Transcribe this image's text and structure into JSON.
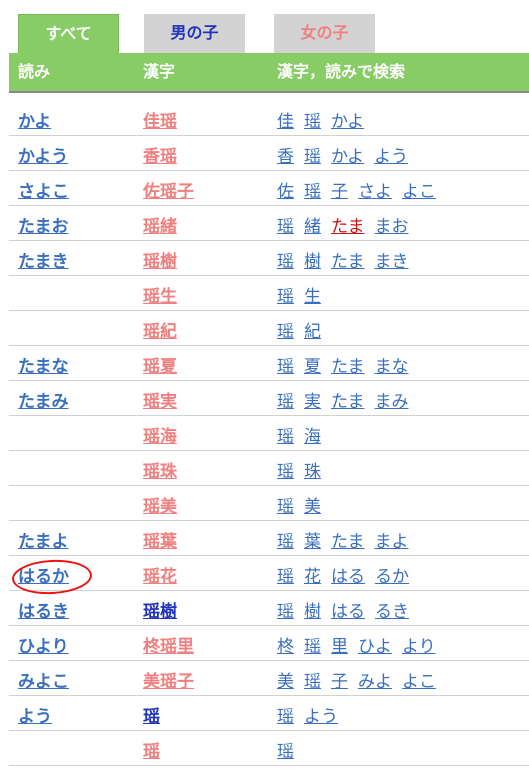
{
  "tabs": [
    {
      "label": "すべて",
      "active": true
    },
    {
      "label": "男の子",
      "active": false
    },
    {
      "label": "女の子",
      "active": false
    }
  ],
  "header": {
    "yomi": "読み",
    "kanji": "漢字",
    "search": "漢字，読みで検索"
  },
  "colors": {
    "tab_active_bg": "#88cc66",
    "header_bg": "#88cc66",
    "link_blue": "#3a6fbf",
    "girl_pink": "#f08080",
    "boy_blue": "#2233bb",
    "visited_red": "#cc1111",
    "annotation_red": "#ee1111"
  },
  "rows": [
    {
      "yomi": "かよ",
      "kanji": "佳瑶",
      "gender": "girl",
      "links": [
        {
          "t": "佳"
        },
        {
          "t": "瑶"
        },
        {
          "t": "かよ"
        }
      ]
    },
    {
      "yomi": "かよう",
      "kanji": "香瑶",
      "gender": "girl",
      "links": [
        {
          "t": "香"
        },
        {
          "t": "瑶"
        },
        {
          "t": "かよ"
        },
        {
          "t": "よう"
        }
      ]
    },
    {
      "yomi": "さよこ",
      "kanji": "佐瑶子",
      "gender": "girl",
      "links": [
        {
          "t": "佐"
        },
        {
          "t": "瑶"
        },
        {
          "t": "子"
        },
        {
          "t": "さよ"
        },
        {
          "t": "よこ"
        }
      ]
    },
    {
      "yomi": "たまお",
      "kanji": "瑶緒",
      "gender": "girl",
      "links": [
        {
          "t": "瑶"
        },
        {
          "t": "緒"
        },
        {
          "t": "たま",
          "visited": true
        },
        {
          "t": "まお"
        }
      ]
    },
    {
      "yomi": "たまき",
      "kanji": "瑶樹",
      "gender": "girl",
      "links": [
        {
          "t": "瑶"
        },
        {
          "t": "樹"
        },
        {
          "t": "たま"
        },
        {
          "t": "まき"
        }
      ]
    },
    {
      "yomi": "",
      "kanji": "瑶生",
      "gender": "girl",
      "links": [
        {
          "t": "瑶"
        },
        {
          "t": "生"
        }
      ]
    },
    {
      "yomi": "",
      "kanji": "瑶紀",
      "gender": "girl",
      "links": [
        {
          "t": "瑶"
        },
        {
          "t": "紀"
        }
      ]
    },
    {
      "yomi": "たまな",
      "kanji": "瑶夏",
      "gender": "girl",
      "links": [
        {
          "t": "瑶"
        },
        {
          "t": "夏"
        },
        {
          "t": "たま"
        },
        {
          "t": "まな"
        }
      ]
    },
    {
      "yomi": "たまみ",
      "kanji": "瑶実",
      "gender": "girl",
      "links": [
        {
          "t": "瑶"
        },
        {
          "t": "実"
        },
        {
          "t": "たま"
        },
        {
          "t": "まみ"
        }
      ]
    },
    {
      "yomi": "",
      "kanji": "瑶海",
      "gender": "girl",
      "links": [
        {
          "t": "瑶"
        },
        {
          "t": "海"
        }
      ]
    },
    {
      "yomi": "",
      "kanji": "瑶珠",
      "gender": "girl",
      "links": [
        {
          "t": "瑶"
        },
        {
          "t": "珠"
        }
      ]
    },
    {
      "yomi": "",
      "kanji": "瑶美",
      "gender": "girl",
      "links": [
        {
          "t": "瑶"
        },
        {
          "t": "美"
        }
      ]
    },
    {
      "yomi": "たまよ",
      "kanji": "瑶葉",
      "gender": "girl",
      "links": [
        {
          "t": "瑶"
        },
        {
          "t": "葉"
        },
        {
          "t": "たま"
        },
        {
          "t": "まよ"
        }
      ]
    },
    {
      "yomi": "はるか",
      "kanji": "瑶花",
      "gender": "girl",
      "annotated": true,
      "links": [
        {
          "t": "瑶"
        },
        {
          "t": "花"
        },
        {
          "t": "はる"
        },
        {
          "t": "るか"
        }
      ]
    },
    {
      "yomi": "はるき",
      "kanji": "瑶樹",
      "gender": "boy",
      "links": [
        {
          "t": "瑶"
        },
        {
          "t": "樹"
        },
        {
          "t": "はる"
        },
        {
          "t": "るき"
        }
      ]
    },
    {
      "yomi": "ひより",
      "kanji": "柊瑶里",
      "gender": "girl",
      "links": [
        {
          "t": "柊"
        },
        {
          "t": "瑶"
        },
        {
          "t": "里"
        },
        {
          "t": "ひよ"
        },
        {
          "t": "より"
        }
      ]
    },
    {
      "yomi": "みよこ",
      "kanji": "美瑶子",
      "gender": "girl",
      "links": [
        {
          "t": "美"
        },
        {
          "t": "瑶"
        },
        {
          "t": "子"
        },
        {
          "t": "みよ"
        },
        {
          "t": "よこ"
        }
      ]
    },
    {
      "yomi": "よう",
      "kanji": "瑶",
      "gender": "boy",
      "links": [
        {
          "t": "瑶"
        },
        {
          "t": "よう"
        }
      ]
    },
    {
      "yomi": "",
      "kanji": "瑶",
      "gender": "girl",
      "links": [
        {
          "t": "瑶"
        }
      ]
    }
  ]
}
